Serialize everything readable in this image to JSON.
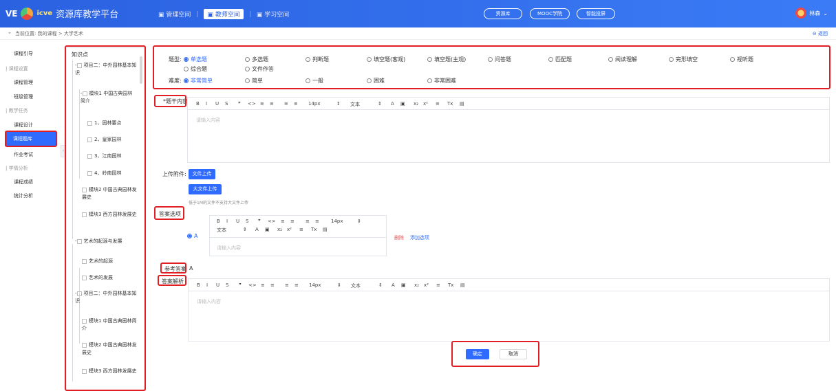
{
  "header": {
    "brand_ve": "VE",
    "brand_icve": "icve",
    "title": "资源库教学平台",
    "nav": [
      "管理空间",
      "教师空间",
      "学习空间"
    ],
    "buttons": [
      "资源库",
      "MOOC学院",
      "智能投屏"
    ],
    "user": "林森"
  },
  "crumb": {
    "text": "当前位置: 我的课程 > 大学艺术",
    "back": "返回"
  },
  "sidebar": {
    "items": [
      {
        "label": "课程引导",
        "group": false,
        "active": false
      },
      {
        "label": "课程设置",
        "group": true,
        "active": false
      },
      {
        "label": "课程管理",
        "group": false,
        "active": false
      },
      {
        "label": "班级管理",
        "group": false,
        "active": false
      },
      {
        "label": "教学任务",
        "group": true,
        "active": false
      },
      {
        "label": "课程设计",
        "group": false,
        "active": false
      },
      {
        "label": "课程题库",
        "group": false,
        "active": true
      },
      {
        "label": "作业考试",
        "group": false,
        "active": false
      },
      {
        "label": "学情分析",
        "group": true,
        "active": false
      },
      {
        "label": "课程成绩",
        "group": false,
        "active": false
      },
      {
        "label": "统计分析",
        "group": false,
        "active": false
      }
    ]
  },
  "knowledge": {
    "title": "知识点",
    "nodes": [
      "项目二：中外园林基本知识",
      "模块1 中国古典园林简介",
      "1、园林要点",
      "2、皇家园林",
      "3、江南园林",
      "4、岭南园林",
      "模块2 中国古典园林发展史",
      "模块3 西方园林发展史",
      "艺术的起源与发展",
      "艺术的起源",
      "艺术的发展",
      "项目二：中外园林基本知识",
      "模块1 中国古典园林简介",
      "模块2 中国古典园林发展史",
      "模块3 西方园林发展史"
    ]
  },
  "question": {
    "type_label": "题型:",
    "types": [
      "单选题",
      "多选题",
      "判断题",
      "填空题(客观)",
      "填空题(主观)",
      "问答题",
      "匹配题",
      "阅读理解",
      "完形填空",
      "视听题",
      "综合题",
      "文件作答"
    ],
    "difficulty_label": "难度:",
    "difficulties": [
      "非常简单",
      "简单",
      "一般",
      "困难",
      "非常困难"
    ],
    "stem_label": "*题干内容",
    "placeholder": "请输入内容",
    "toolbar": [
      "B",
      "I",
      "U",
      "S",
      "❞",
      "<>",
      "≡",
      "≡",
      "≡",
      "≡",
      "14px",
      "⇕",
      "文本",
      "⇕",
      "A",
      "▣",
      "x₂",
      "x²",
      "≡",
      "Tx",
      "▤"
    ],
    "attach_label": "上传附件:",
    "file_upload": "文件上传",
    "big_file_upload": "大文件上传",
    "upload_hint": "低于1M的文件不支持大文件上传",
    "options_label": "答案选项",
    "option_a": "A",
    "delete": "删除",
    "add_option": "添加选项",
    "ref_answer_label": "参考答案",
    "ref_answer_value": "A",
    "analysis_label": "答案解析",
    "confirm": "确定",
    "cancel": "取消"
  }
}
